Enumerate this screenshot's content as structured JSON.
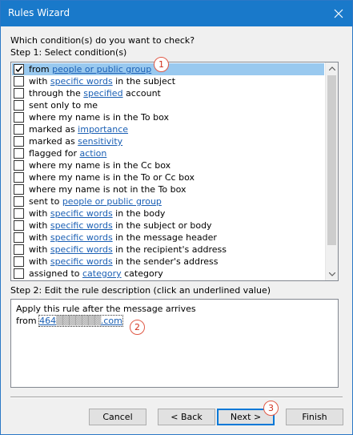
{
  "window": {
    "title": "Rules Wizard"
  },
  "question": "Which condition(s) do you want to check?",
  "step1_label": "Step 1: Select condition(s)",
  "conditions": [
    {
      "pre": "from ",
      "link": "people or public group",
      "post": "",
      "checked": true,
      "selected": true
    },
    {
      "pre": "with ",
      "link": "specific words",
      "post": " in the subject",
      "checked": false,
      "selected": false
    },
    {
      "pre": "through the ",
      "link": "specified",
      "post": " account",
      "checked": false,
      "selected": false
    },
    {
      "pre": "sent only to me",
      "link": "",
      "post": "",
      "checked": false,
      "selected": false
    },
    {
      "pre": "where my name is in the To box",
      "link": "",
      "post": "",
      "checked": false,
      "selected": false
    },
    {
      "pre": "marked as ",
      "link": "importance",
      "post": "",
      "checked": false,
      "selected": false
    },
    {
      "pre": "marked as ",
      "link": "sensitivity",
      "post": "",
      "checked": false,
      "selected": false
    },
    {
      "pre": "flagged for ",
      "link": "action",
      "post": "",
      "checked": false,
      "selected": false
    },
    {
      "pre": "where my name is in the Cc box",
      "link": "",
      "post": "",
      "checked": false,
      "selected": false
    },
    {
      "pre": "where my name is in the To or Cc box",
      "link": "",
      "post": "",
      "checked": false,
      "selected": false
    },
    {
      "pre": "where my name is not in the To box",
      "link": "",
      "post": "",
      "checked": false,
      "selected": false
    },
    {
      "pre": "sent to ",
      "link": "people or public group",
      "post": "",
      "checked": false,
      "selected": false
    },
    {
      "pre": "with ",
      "link": "specific words",
      "post": " in the body",
      "checked": false,
      "selected": false
    },
    {
      "pre": "with ",
      "link": "specific words",
      "post": " in the subject or body",
      "checked": false,
      "selected": false
    },
    {
      "pre": "with ",
      "link": "specific words",
      "post": " in the message header",
      "checked": false,
      "selected": false
    },
    {
      "pre": "with ",
      "link": "specific words",
      "post": " in the recipient's address",
      "checked": false,
      "selected": false
    },
    {
      "pre": "with ",
      "link": "specific words",
      "post": " in the sender's address",
      "checked": false,
      "selected": false
    },
    {
      "pre": "assigned to ",
      "link": "category",
      "post": " category",
      "checked": false,
      "selected": false
    }
  ],
  "step2_label": "Step 2: Edit the rule description (click an underlined value)",
  "description": {
    "line1": "Apply this rule after the message arrives",
    "from_prefix": "from ",
    "from_value_start": "464",
    "from_value_obscured": "▒▒▒▒▒▒▒",
    "from_value_end": ".com"
  },
  "buttons": {
    "cancel": "Cancel",
    "back": "< Back",
    "next": "Next >",
    "finish": "Finish"
  },
  "badges": {
    "one": "1",
    "two": "2",
    "three": "3"
  },
  "colors": {
    "titlebar": "#1979ca",
    "selection": "#99c9ef",
    "link": "#1a5fb4",
    "badge": "#d0301c"
  }
}
